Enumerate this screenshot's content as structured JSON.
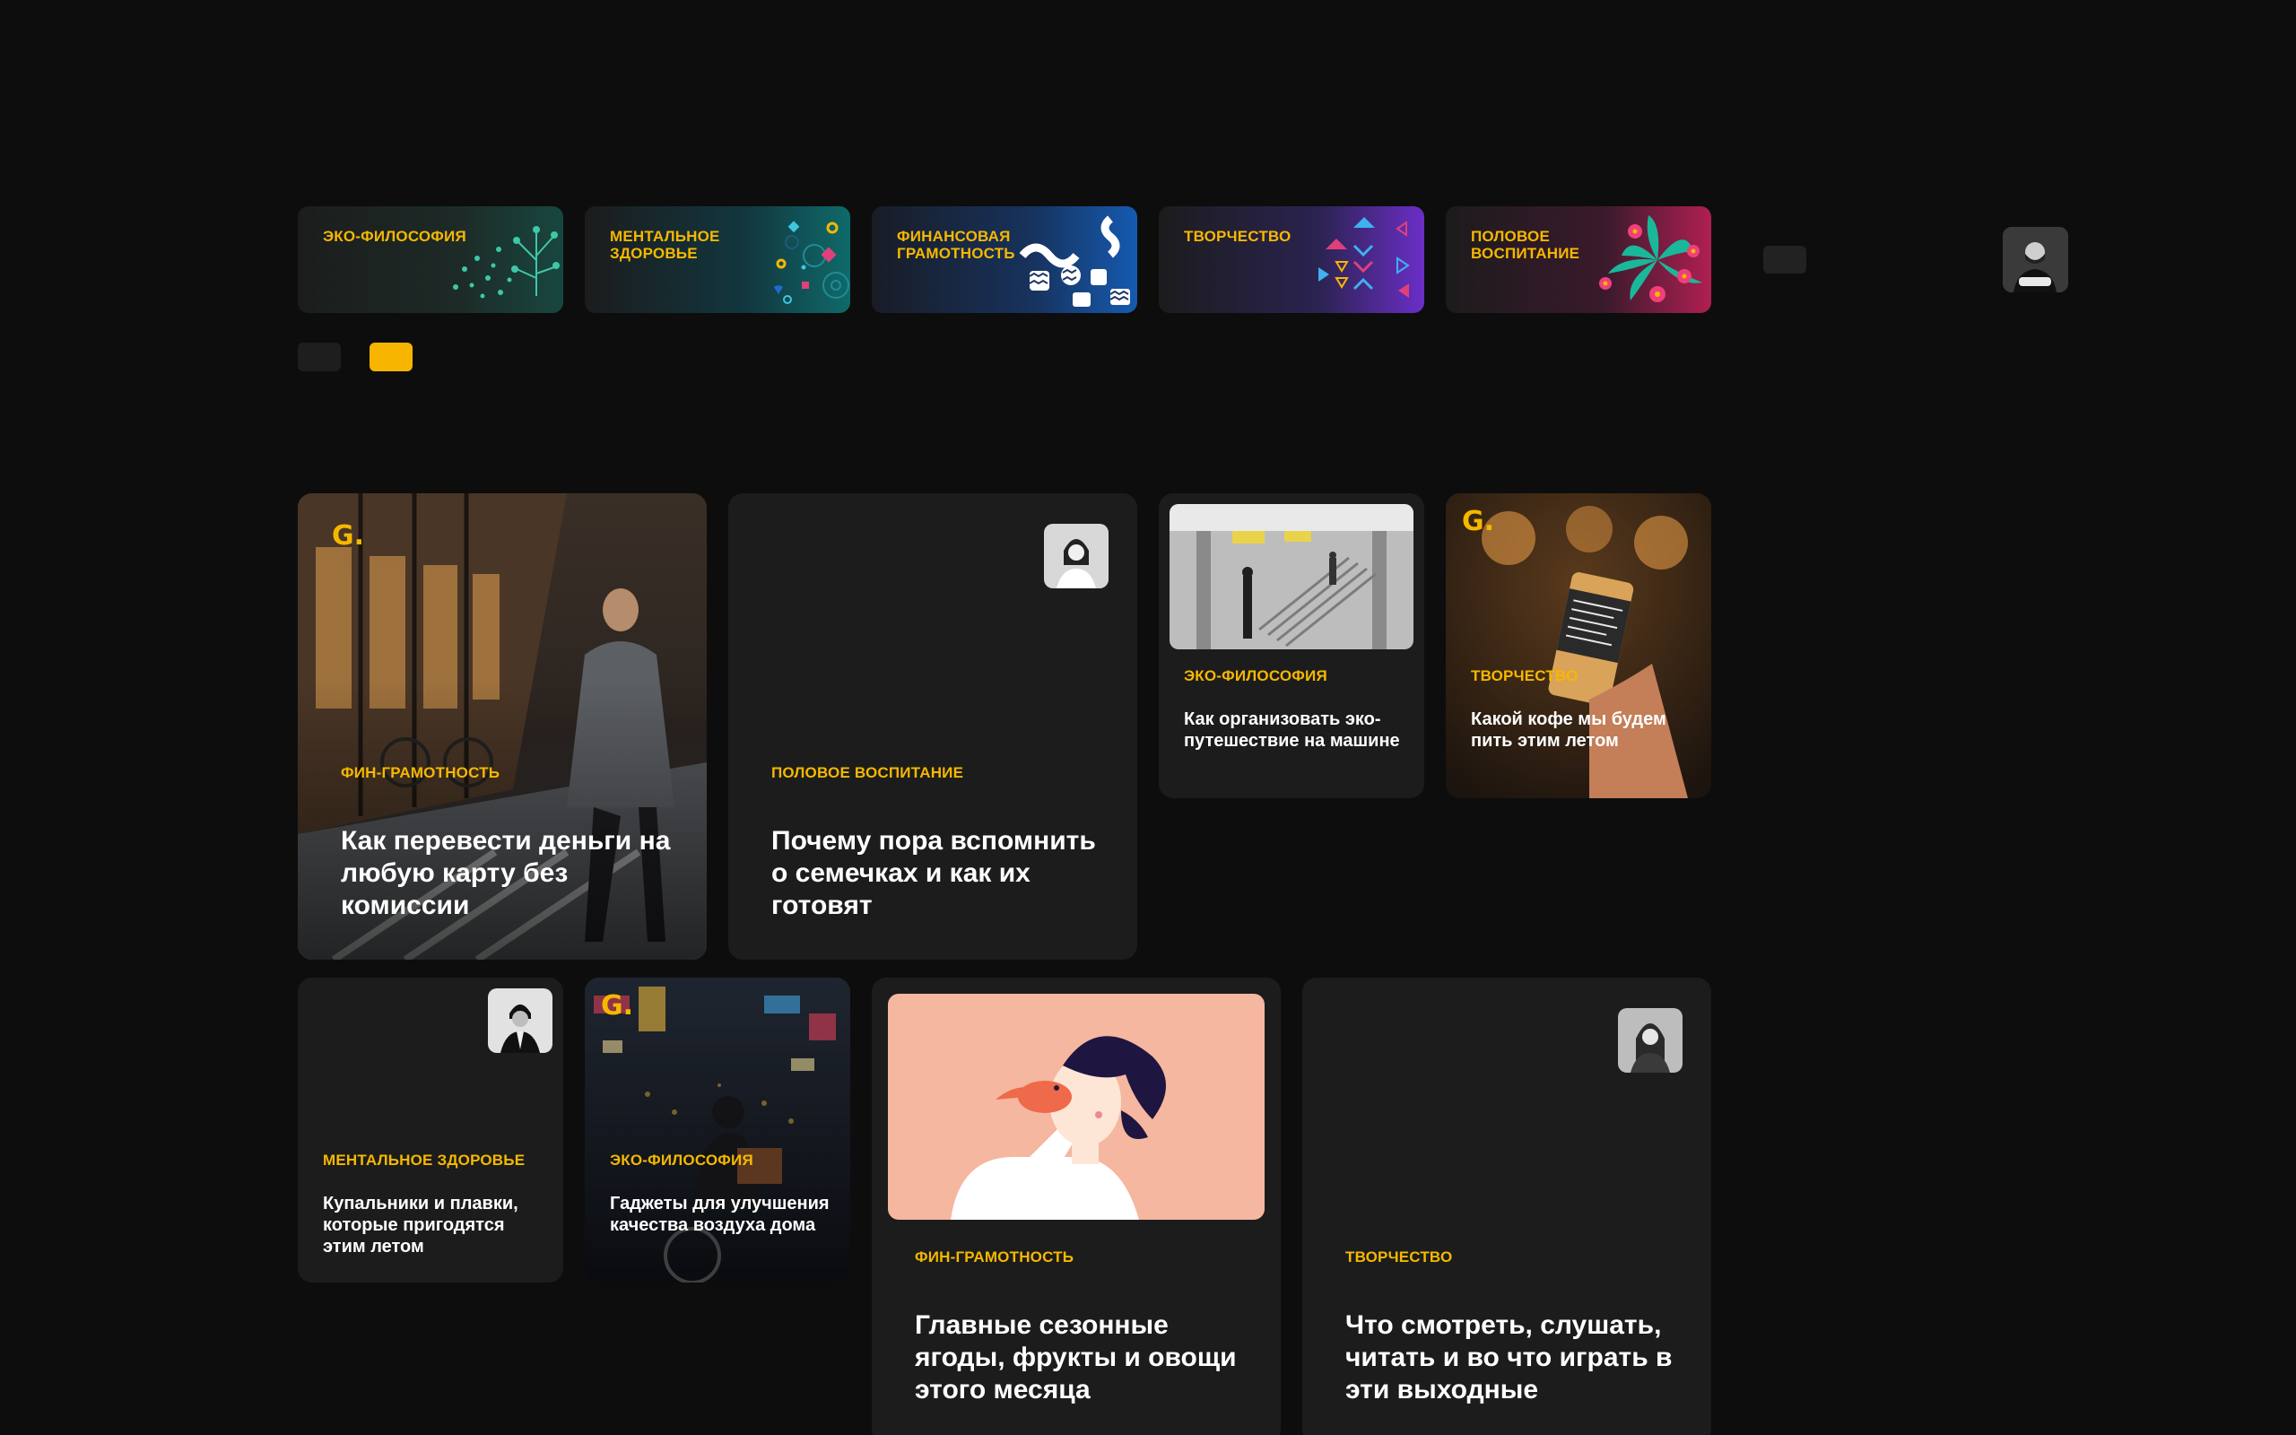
{
  "categories": [
    {
      "label": "Эко-философия",
      "icon": "eco-dots-icon"
    },
    {
      "label": "Ментальное здоровье",
      "icon": "shapes-icon"
    },
    {
      "label": "Финансовая грамотность",
      "icon": "zigzag-icon"
    },
    {
      "label": "Творчество",
      "icon": "triangles-icon"
    },
    {
      "label": "Половое воспитание",
      "icon": "flowers-icon"
    }
  ],
  "brand": {
    "logo": "G.",
    "accent": "#f5b800"
  },
  "articles": [
    {
      "tag": "Фин-грамотность",
      "title": "Как перевести деньги на любую карту без комиссии"
    },
    {
      "tag": "Половое воспитание",
      "title": "Почему пора вспомнить о семечках и как их готовят"
    },
    {
      "tag": "Эко-философия",
      "title": "Как организовать эко-путешествие на машине"
    },
    {
      "tag": "Творчество",
      "title": "Какой кофе мы будем пить этим летом"
    },
    {
      "tag": "Ментальное здоровье",
      "title": "Купальники и плавки, которые пригодятся этим летом"
    },
    {
      "tag": "Эко-философия",
      "title": "Гаджеты для улучшения качества воздуха дома"
    },
    {
      "tag": "Фин-грамотность",
      "title": "Главные сезонные ягоды, фрукты и овощи этого месяца"
    },
    {
      "tag": "Творчество",
      "title": "Что смотреть, слушать, читать и во что играть в эти выходные"
    }
  ]
}
